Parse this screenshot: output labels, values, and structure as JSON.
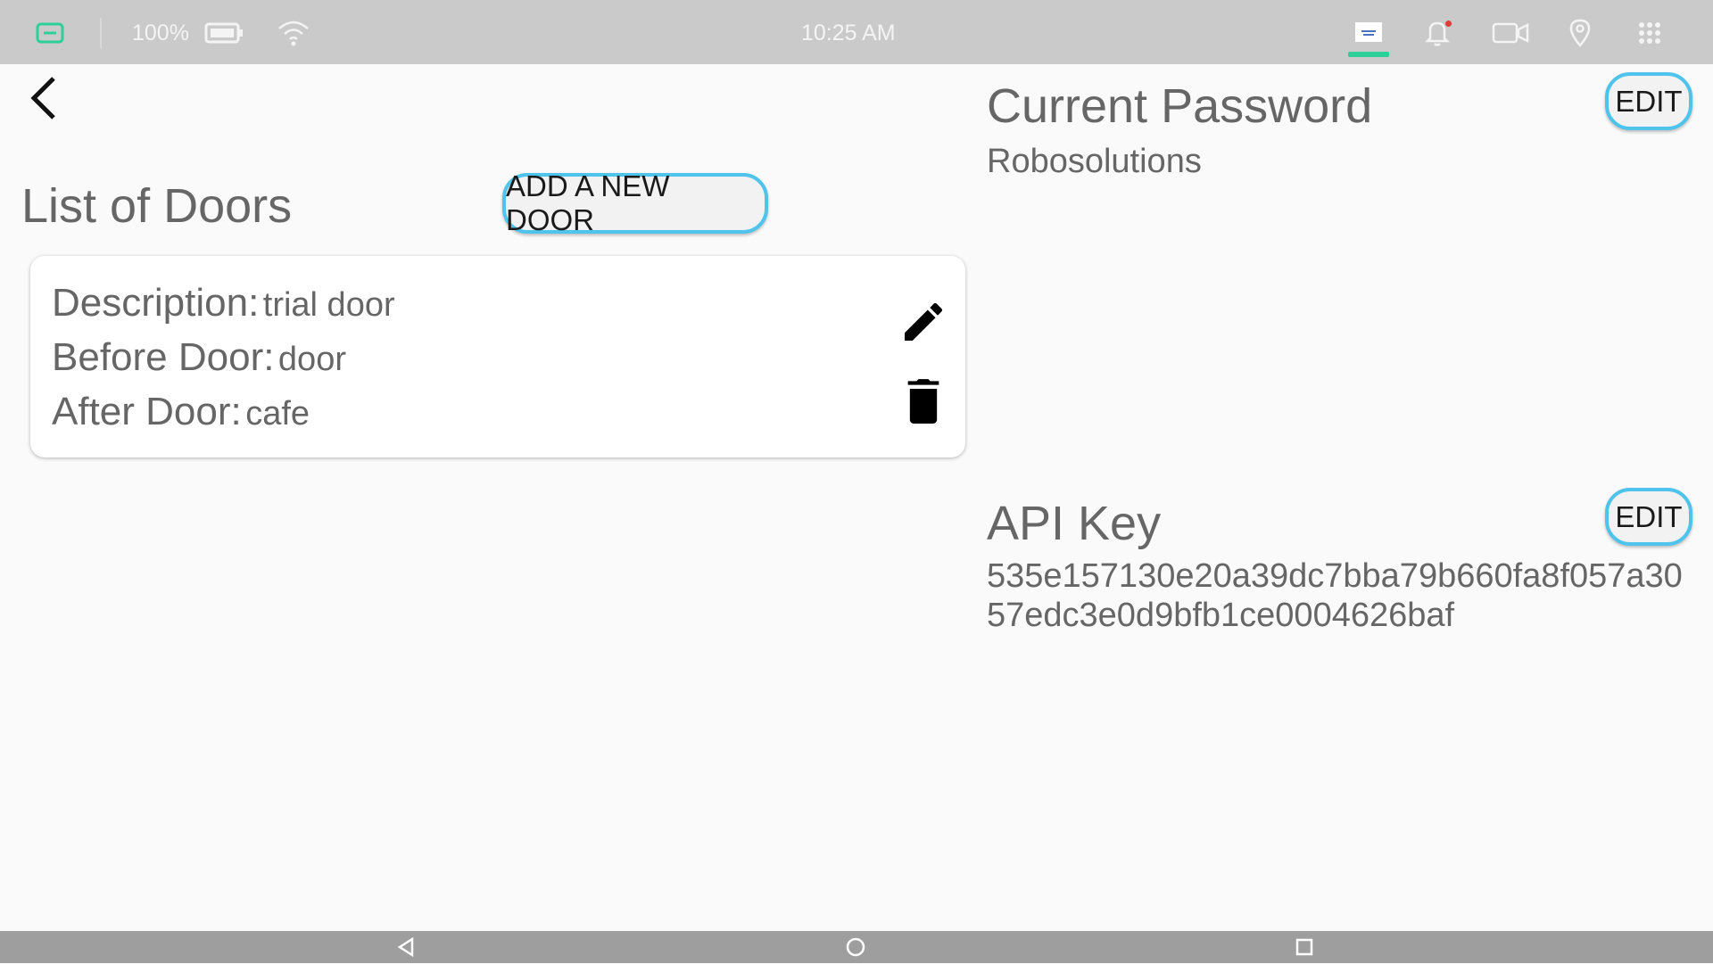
{
  "status_bar": {
    "battery_percent": "100%",
    "time": "10:25 AM"
  },
  "doors": {
    "title": "List of Doors",
    "add_button_label": "ADD A NEW DOOR",
    "items": [
      {
        "description_label": "Description:",
        "description": "trial door",
        "before_label": "Before Door:",
        "before": "door",
        "after_label": "After Door:",
        "after": "cafe"
      }
    ]
  },
  "password": {
    "title": "Current Password",
    "value": "Robosolutions",
    "edit_label": "EDIT"
  },
  "api_key": {
    "title": "API Key",
    "value": "535e157130e20a39dc7bba79b660fa8f057a3057edc3e0d9bfb1ce0004626baf",
    "edit_label": "EDIT"
  },
  "colors": {
    "accent_border": "#4ec3ec",
    "status_bar_bg": "#cacaca",
    "nav_bar_bg": "#9e9e9e",
    "tab_indicator": "#2fcf9a"
  },
  "icons": {
    "status_bar": [
      "app-icon",
      "battery-icon",
      "wifi-icon",
      "app-thumbnail-icon",
      "bell-icon",
      "video-camera-icon",
      "location-pin-icon",
      "grid-menu-icon"
    ],
    "nav_bar": [
      "back-triangle-icon",
      "home-circle-icon",
      "recents-square-icon"
    ],
    "door_actions": [
      "pencil-icon",
      "trash-icon"
    ]
  }
}
